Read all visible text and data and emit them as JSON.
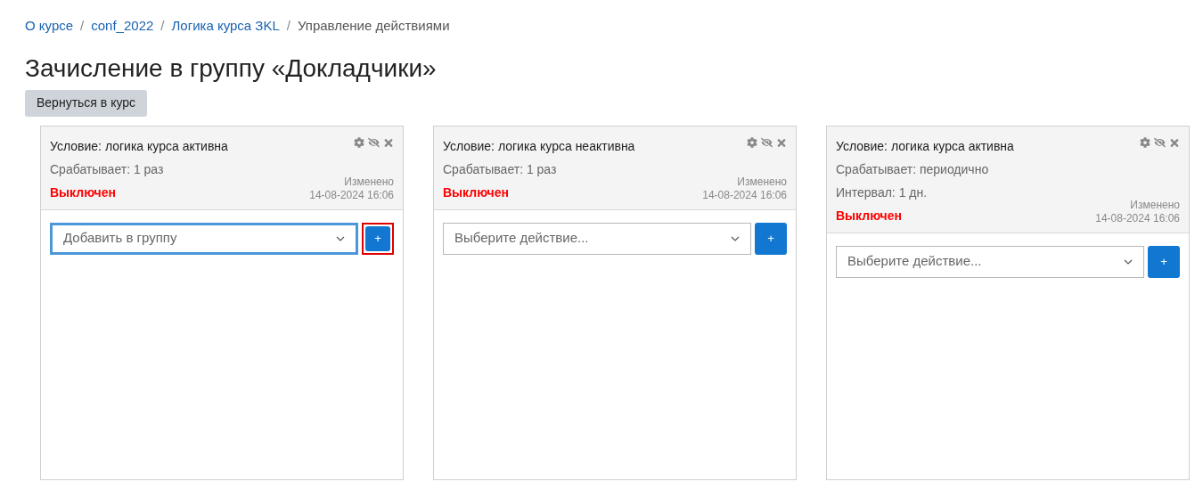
{
  "breadcrumb": [
    {
      "kind": "link",
      "label": "О курсе"
    },
    {
      "kind": "separator",
      "label": "/"
    },
    {
      "kind": "link",
      "label": "conf_2022"
    },
    {
      "kind": "separator",
      "label": "/"
    },
    {
      "kind": "link",
      "label": "Логика курса ЗKL"
    },
    {
      "kind": "separator",
      "label": "/"
    },
    {
      "kind": "current",
      "label": "Управление действиями"
    }
  ],
  "title": "Зачисление в группу «Докладчики»",
  "back_button": "Вернуться в курс",
  "cards": [
    {
      "condition": "Условие: логика курса активна",
      "details": [
        "Срабатывает: 1 раз"
      ],
      "status": "Выключен",
      "modified_label": "Изменено",
      "modified": "14-08-2024 16:06",
      "select": {
        "value": "Добавить в группу",
        "focused": true
      },
      "add_button": {
        "label": "+",
        "highlighted": true
      }
    },
    {
      "condition": "Условие: логика курса неактивна",
      "details": [
        "Срабатывает: 1 раз"
      ],
      "status": "Выключен",
      "modified_label": "Изменено",
      "modified": "14-08-2024 16:06",
      "select": {
        "placeholder": "Выберите действие...",
        "focused": false
      },
      "add_button": {
        "label": "+",
        "highlighted": false
      }
    },
    {
      "condition": "Условие: логика курса активна",
      "details": [
        "Срабатывает: периодично",
        "Интервал: 1 дн."
      ],
      "status": "Выключен",
      "modified_label": "Изменено",
      "modified": "14-08-2024 16:06",
      "select": {
        "placeholder": "Выберите действие...",
        "focused": false
      },
      "add_button": {
        "label": "+",
        "highlighted": false
      }
    }
  ]
}
